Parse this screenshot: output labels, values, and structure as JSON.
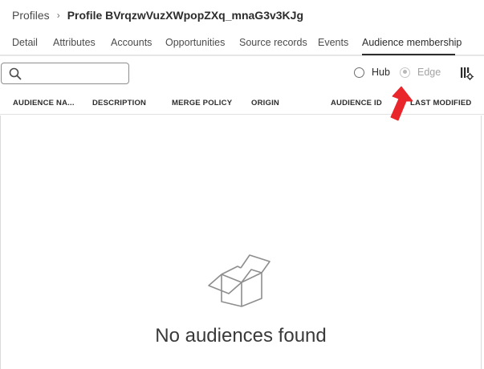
{
  "breadcrumb": {
    "parent": "Profiles",
    "separator": "›",
    "current": "Profile BVrqzwVuzXWpopZXq_mnaG3v3KJg"
  },
  "tabs": [
    {
      "label": "Detail",
      "active": false
    },
    {
      "label": "Attributes",
      "active": false
    },
    {
      "label": "Accounts",
      "active": false
    },
    {
      "label": "Opportunities",
      "active": false
    },
    {
      "label": "Source records",
      "active": false
    },
    {
      "label": "Events",
      "active": false
    },
    {
      "label": "Audience membership",
      "active": true
    }
  ],
  "search": {
    "value": "",
    "placeholder": "",
    "icon": "search-icon"
  },
  "toggle": {
    "hub": {
      "label": "Hub",
      "selected": false,
      "disabled": false
    },
    "edge": {
      "label": "Edge",
      "selected": true,
      "disabled": true
    }
  },
  "table": {
    "columns": [
      "AUDIENCE NA...",
      "DESCRIPTION",
      "MERGE POLICY",
      "ORIGIN",
      "AUDIENCE ID",
      "LAST MODIFIED"
    ],
    "rows": []
  },
  "empty_state": {
    "icon": "empty-box-icon",
    "message": "No audiences found"
  },
  "annotation": {
    "icon": "red-arrow-icon",
    "color": "#e8262b"
  },
  "colors": {
    "text": "#2c2c2c",
    "tab_active_underline": "#2c2c2c",
    "arrow": "#e8262b"
  }
}
